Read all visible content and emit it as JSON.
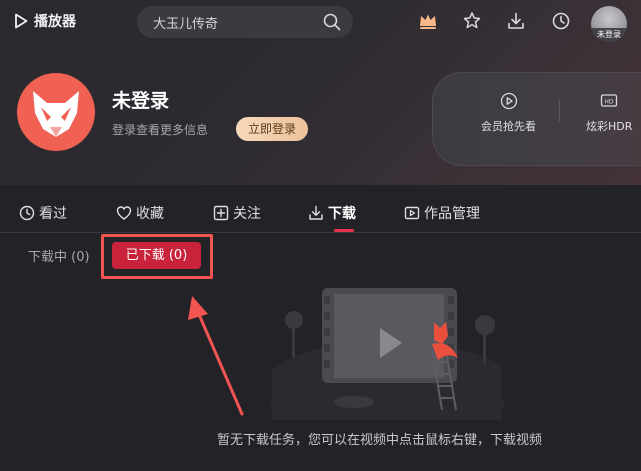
{
  "topbar": {
    "play_label": "播放器",
    "search_value": "大玉儿传奇",
    "avatar_label": "未登录"
  },
  "profile": {
    "username": "未登录",
    "hint": "登录查看更多信息",
    "login_button": "立即登录"
  },
  "vip": {
    "items": [
      {
        "label": "会员抢先看",
        "icon": "play-circle-icon"
      },
      {
        "label": "炫彩HDR",
        "icon": "hdr-icon"
      }
    ]
  },
  "tabs": [
    {
      "label": "看过",
      "icon": "clock-icon"
    },
    {
      "label": "收藏",
      "icon": "heart-icon"
    },
    {
      "label": "关注",
      "icon": "plus-square-icon"
    },
    {
      "label": "下载",
      "icon": "download-icon",
      "active": true
    },
    {
      "label": "作品管理",
      "icon": "video-icon"
    }
  ],
  "subtabs": {
    "downloading": "下载中 (0)",
    "downloaded": "已下载 (0)"
  },
  "empty": {
    "message": "暂无下载任务，您可以在视频中点击鼠标右键，下载视频"
  },
  "colors": {
    "accent": "#e8314a",
    "button_bg": "#c8233a",
    "annotation": "#f25451",
    "login_gold": "#f6d9b9"
  }
}
